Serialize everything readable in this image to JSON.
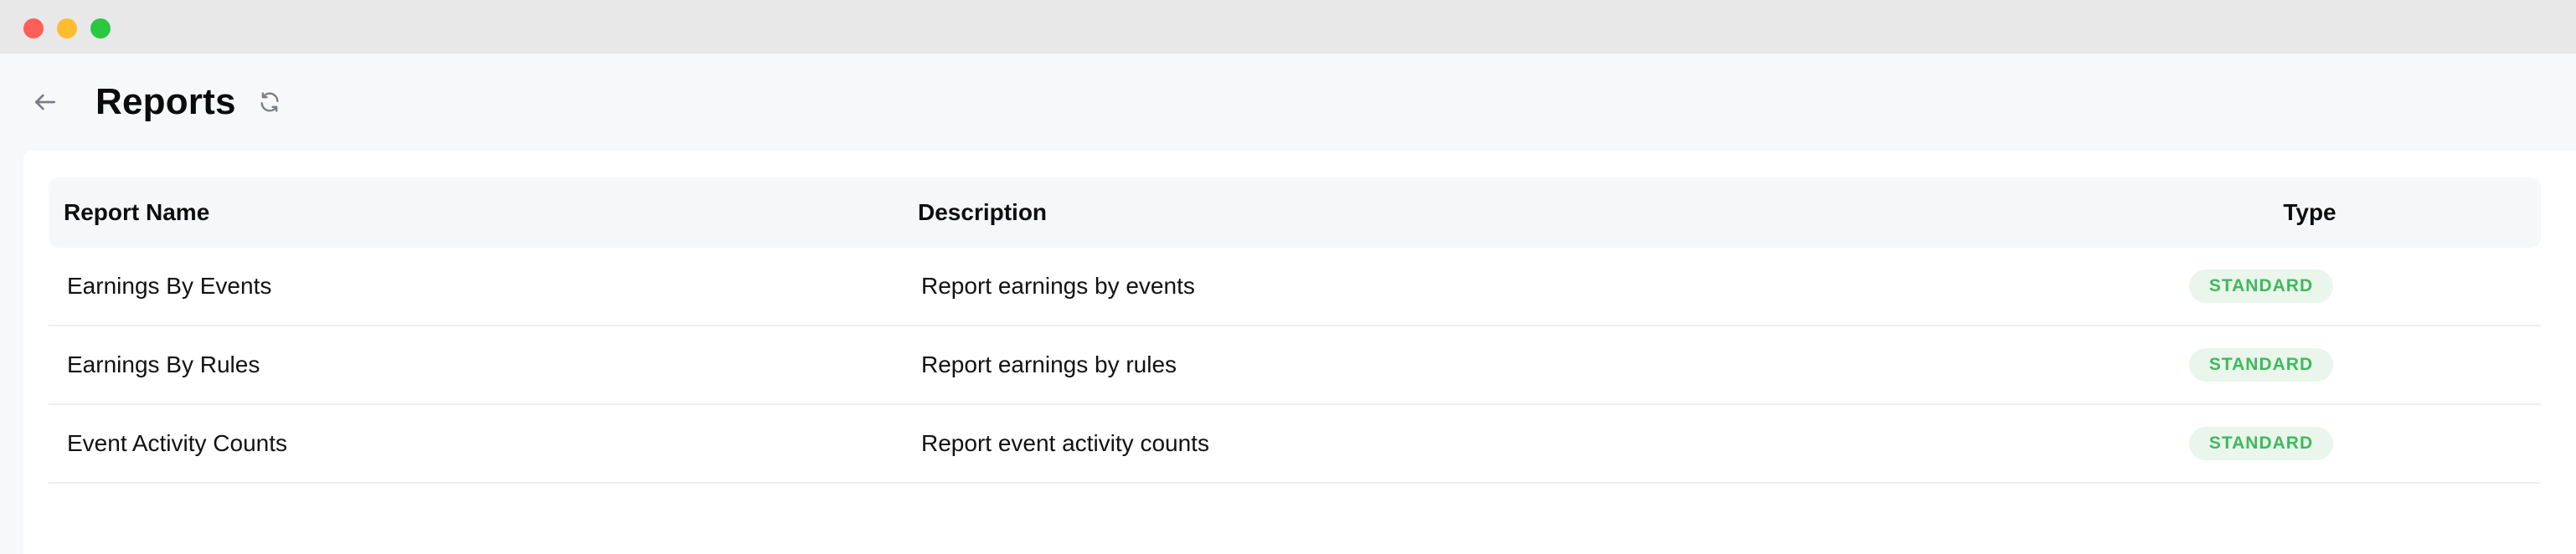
{
  "window": {
    "controls": [
      "close",
      "minimize",
      "maximize"
    ]
  },
  "header": {
    "title": "Reports",
    "back_icon": "arrow-left-icon",
    "refresh_icon": "refresh-icon"
  },
  "table": {
    "columns": {
      "name": "Report Name",
      "description": "Description",
      "type": "Type"
    },
    "rows": [
      {
        "name": "Earnings By Events",
        "description": "Report earnings by events",
        "type": "STANDARD"
      },
      {
        "name": "Earnings By Rules",
        "description": "Report earnings by rules",
        "type": "STANDARD"
      },
      {
        "name": "Event Activity Counts",
        "description": "Report event activity counts",
        "type": "STANDARD"
      }
    ]
  },
  "colors": {
    "badge_text": "#3fb95b",
    "badge_bg": "#eaf6ec",
    "header_bg": "#f6f7f9",
    "page_bg": "#f7f8fa"
  }
}
